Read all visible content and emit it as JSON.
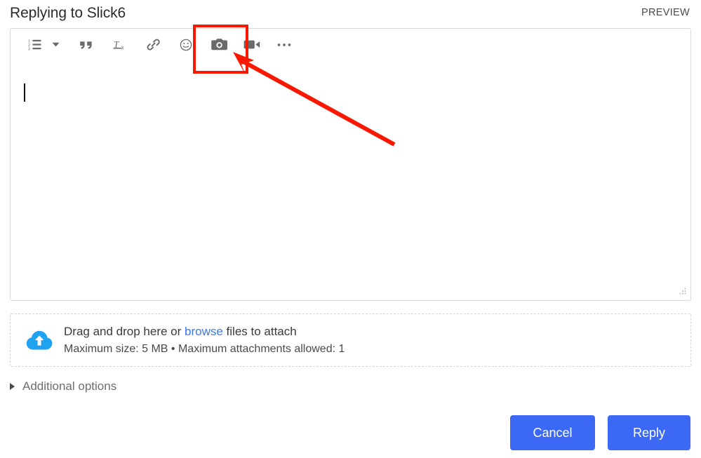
{
  "header": {
    "title": "Replying to Slick6",
    "preview_label": "PREVIEW"
  },
  "toolbar": {
    "items": [
      {
        "name": "numbered-list-icon",
        "label": "Numbered list"
      },
      {
        "name": "chevron-down-icon",
        "label": "List options"
      },
      {
        "name": "blockquote-icon",
        "label": "Blockquote"
      },
      {
        "name": "remove-formatting-icon",
        "label": "Remove formatting"
      },
      {
        "name": "link-icon",
        "label": "Insert link"
      },
      {
        "name": "emoji-icon",
        "label": "Insert emoji"
      },
      {
        "name": "camera-icon",
        "label": "Insert image"
      },
      {
        "name": "video-camera-icon",
        "label": "Insert video"
      },
      {
        "name": "more-options-icon",
        "label": "More options"
      }
    ]
  },
  "compose": {
    "value": "",
    "placeholder": ""
  },
  "dropzone": {
    "line1_prefix": "Drag and drop here or ",
    "browse_label": "browse",
    "line1_suffix": " files to attach",
    "line2": "Maximum size: 5 MB • Maximum attachments allowed: 1"
  },
  "additional_options": {
    "label": "Additional options"
  },
  "footer": {
    "cancel_label": "Cancel",
    "reply_label": "Reply"
  },
  "colors": {
    "accent_blue": "#3b68f5",
    "link_blue": "#3b78e7",
    "cloud_blue": "#1fa2f0",
    "annotation_red": "#fb1800",
    "icon_gray": "#6b6b6b",
    "border_gray": "#d8d8d8"
  },
  "annotation": {
    "highlight_target": "camera-icon",
    "shape": "rectangle-with-arrow"
  }
}
